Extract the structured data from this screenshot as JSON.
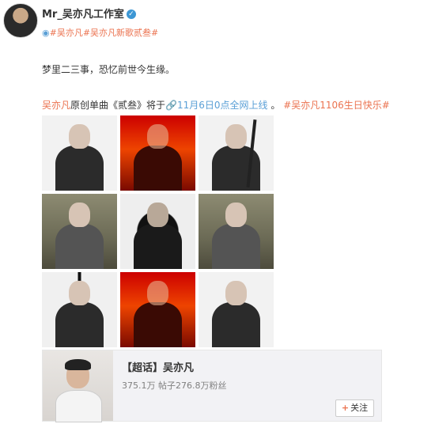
{
  "user": {
    "name": "Mr_吴亦凡工作室",
    "verified_icon": "✓",
    "tags_pin_icon": "📍",
    "tags_text": "#吴亦凡#吴亦凡新歌贰叁#"
  },
  "post": {
    "line1": "梦里二三事，恐忆前世今生缘。",
    "name": "吴亦凡",
    "mid": "原创单曲《贰叁》将于",
    "link_icon": "🔗",
    "link_text": "11月6日0点全网上线",
    "dot": " 。",
    "tag": "#吴亦凡1106生日快乐#"
  },
  "photos": [
    {
      "style": "white"
    },
    {
      "style": "red"
    },
    {
      "style": "white-sword"
    },
    {
      "style": "field"
    },
    {
      "style": "ink"
    },
    {
      "style": "field"
    },
    {
      "style": "split"
    },
    {
      "style": "red"
    },
    {
      "style": "white"
    }
  ],
  "card": {
    "title": "【超话】吴亦凡",
    "stats": "375.1万 帖子276.8万粉丝",
    "follow_label": "关注",
    "follow_plus": "+"
  }
}
